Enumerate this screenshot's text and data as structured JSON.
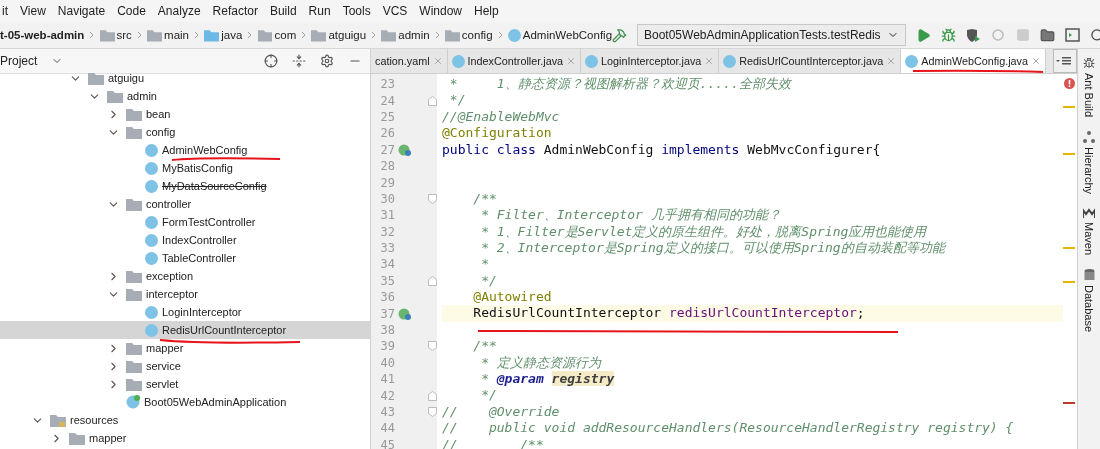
{
  "menu": [
    "it",
    "View",
    "Navigate",
    "Code",
    "Analyze",
    "Refactor",
    "Build",
    "Run",
    "Tools",
    "VCS",
    "Window",
    "Help"
  ],
  "breadcrumbs": [
    {
      "label": "t-05-web-admin",
      "kind": "project"
    },
    {
      "label": "src",
      "kind": "folder"
    },
    {
      "label": "main",
      "kind": "folder"
    },
    {
      "label": "java",
      "kind": "source"
    },
    {
      "label": "com",
      "kind": "package"
    },
    {
      "label": "atguigu",
      "kind": "package"
    },
    {
      "label": "admin",
      "kind": "package"
    },
    {
      "label": "config",
      "kind": "package"
    },
    {
      "label": "AdminWebConfig",
      "kind": "class"
    }
  ],
  "toolbar": {
    "run_config": "Boot05WebAdminApplicationTests.testRedis"
  },
  "project_panel": {
    "title": "Project",
    "package_items": [
      {
        "label": "atguigu",
        "kind": "folder",
        "expanded": true,
        "children": [
          {
            "label": "admin",
            "kind": "folder",
            "expanded": true,
            "children": [
              {
                "label": "bean",
                "kind": "folder",
                "expanded": false
              },
              {
                "label": "config",
                "kind": "folder",
                "expanded": true,
                "children": [
                  {
                    "label": "AdminWebConfig",
                    "kind": "class",
                    "selected": false,
                    "struck": false
                  },
                  {
                    "label": "MyBatisConfig",
                    "kind": "class",
                    "selected": false,
                    "struck": false
                  },
                  {
                    "label": "MyDataSourceConfig",
                    "kind": "class",
                    "selected": false,
                    "struck": true
                  }
                ]
              },
              {
                "label": "controller",
                "kind": "folder",
                "expanded": true,
                "children": [
                  {
                    "label": "FormTestController",
                    "kind": "class",
                    "selected": false,
                    "struck": false
                  },
                  {
                    "label": "IndexController",
                    "kind": "class",
                    "selected": false,
                    "struck": false
                  },
                  {
                    "label": "TableController",
                    "kind": "class",
                    "selected": false,
                    "struck": false
                  }
                ]
              },
              {
                "label": "exception",
                "kind": "folder",
                "expanded": false
              },
              {
                "label": "interceptor",
                "kind": "folder",
                "expanded": true,
                "children": [
                  {
                    "label": "LoginInterceptor",
                    "kind": "class",
                    "selected": false,
                    "struck": false
                  },
                  {
                    "label": "RedisUrlCountInterceptor",
                    "kind": "class",
                    "selected": true,
                    "struck": false
                  }
                ]
              },
              {
                "label": "mapper",
                "kind": "folder",
                "expanded": false
              },
              {
                "label": "service",
                "kind": "folder",
                "expanded": false
              },
              {
                "label": "servlet",
                "kind": "folder",
                "expanded": false
              },
              {
                "label": "Boot05WebAdminApplication",
                "kind": "app",
                "selected": false,
                "struck": false
              }
            ]
          }
        ]
      }
    ],
    "folder_items": [
      {
        "label": "resources",
        "kind": "resources",
        "expanded": true,
        "children": [
          {
            "label": "mapper",
            "kind": "folder",
            "expanded": false
          }
        ]
      }
    ]
  },
  "editor_tabs": [
    {
      "label": "cation.yaml",
      "kind": "yaml",
      "selected": false
    },
    {
      "label": "IndexController.java",
      "kind": "class",
      "selected": false
    },
    {
      "label": "LoginInterceptor.java",
      "kind": "class",
      "selected": false
    },
    {
      "label": "RedisUrlCountInterceptor.java",
      "kind": "class",
      "selected": false
    },
    {
      "label": "AdminWebConfig.java",
      "kind": "class",
      "selected": true
    }
  ],
  "code_lines": [
    {
      "number": "23",
      "tokens": [
        {
          "kind": "comment",
          "text": " *     1、静态资源？视图解析器？欢迎页.....全部失效"
        }
      ]
    },
    {
      "number": "24",
      "fold_end": true,
      "tokens": [
        {
          "kind": "comment",
          "text": " */"
        }
      ]
    },
    {
      "number": "25",
      "tokens": [
        {
          "kind": "comment",
          "text": "//@EnableWebMvc"
        }
      ]
    },
    {
      "number": "26",
      "tokens": [
        {
          "kind": "annotation",
          "text": "@Configuration"
        }
      ]
    },
    {
      "number": "27",
      "bean": true,
      "tokens": [
        {
          "kind": "keyword",
          "text": "public class"
        },
        {
          "kind": "plain",
          "text": " AdminWebConfig "
        },
        {
          "kind": "keyword",
          "text": "implements"
        },
        {
          "kind": "plain",
          "text": " WebMvcConfigurer{"
        }
      ]
    },
    {
      "number": "28"
    },
    {
      "number": "29"
    },
    {
      "number": "30",
      "fold_start": true,
      "tokens": [
        {
          "kind": "comment",
          "text": "    /**"
        }
      ]
    },
    {
      "number": "31",
      "tokens": [
        {
          "kind": "comment",
          "text": "     * Filter、Interceptor 几乎拥有相同的功能？"
        }
      ]
    },
    {
      "number": "32",
      "tokens": [
        {
          "kind": "comment",
          "text": "     * 1、Filter是Servlet定义的原生组件。好处，脱离Spring应用也能使用"
        }
      ]
    },
    {
      "number": "33",
      "tokens": [
        {
          "kind": "comment",
          "text": "     * 2、Interceptor是Spring定义的接口。可以使用Spring的自动装配等功能"
        }
      ]
    },
    {
      "number": "34",
      "tokens": [
        {
          "kind": "comment",
          "text": "     *"
        }
      ]
    },
    {
      "number": "35",
      "fold_end": true,
      "tokens": [
        {
          "kind": "comment",
          "text": "     */"
        }
      ]
    },
    {
      "number": "36",
      "tokens": [
        {
          "kind": "annotation",
          "text": "    @Autowired"
        }
      ]
    },
    {
      "number": "37",
      "bean": true,
      "current": true,
      "tokens": [
        {
          "kind": "plain",
          "text": "    RedisUrlCountInterceptor "
        },
        {
          "kind": "field",
          "text": "redisUrlCountInterceptor"
        },
        {
          "kind": "plain",
          "text": ";"
        }
      ]
    },
    {
      "number": "38"
    },
    {
      "number": "39",
      "fold_start": true,
      "tokens": [
        {
          "kind": "comment",
          "text": "    /**"
        }
      ]
    },
    {
      "number": "40",
      "tokens": [
        {
          "kind": "comment",
          "text": "     * 定义静态资源行为"
        }
      ]
    },
    {
      "number": "41",
      "tokens": [
        {
          "kind": "comment",
          "text": "     * "
        },
        {
          "kind": "doctag",
          "text": "@param "
        },
        {
          "kind": "docparam",
          "text": "registry"
        }
      ]
    },
    {
      "number": "42",
      "fold_end": true,
      "tokens": [
        {
          "kind": "comment",
          "text": "     */"
        }
      ]
    },
    {
      "number": "43",
      "fold_start": true,
      "tokens": [
        {
          "kind": "comment",
          "text": "//    @Override"
        }
      ]
    },
    {
      "number": "44",
      "tokens": [
        {
          "kind": "comment",
          "text": "//    public void addResourceHandlers(ResourceHandlerRegistry registry) {"
        }
      ]
    },
    {
      "number": "45",
      "tokens": [
        {
          "kind": "comment",
          "text": "//        /**"
        }
      ]
    }
  ],
  "tool_strip": [
    {
      "label": "Ant Build",
      "kind": "ant"
    },
    {
      "label": "Hierarchy",
      "kind": "hierarchy"
    },
    {
      "label": "Maven",
      "kind": "maven"
    },
    {
      "label": "Database",
      "kind": "database"
    }
  ]
}
